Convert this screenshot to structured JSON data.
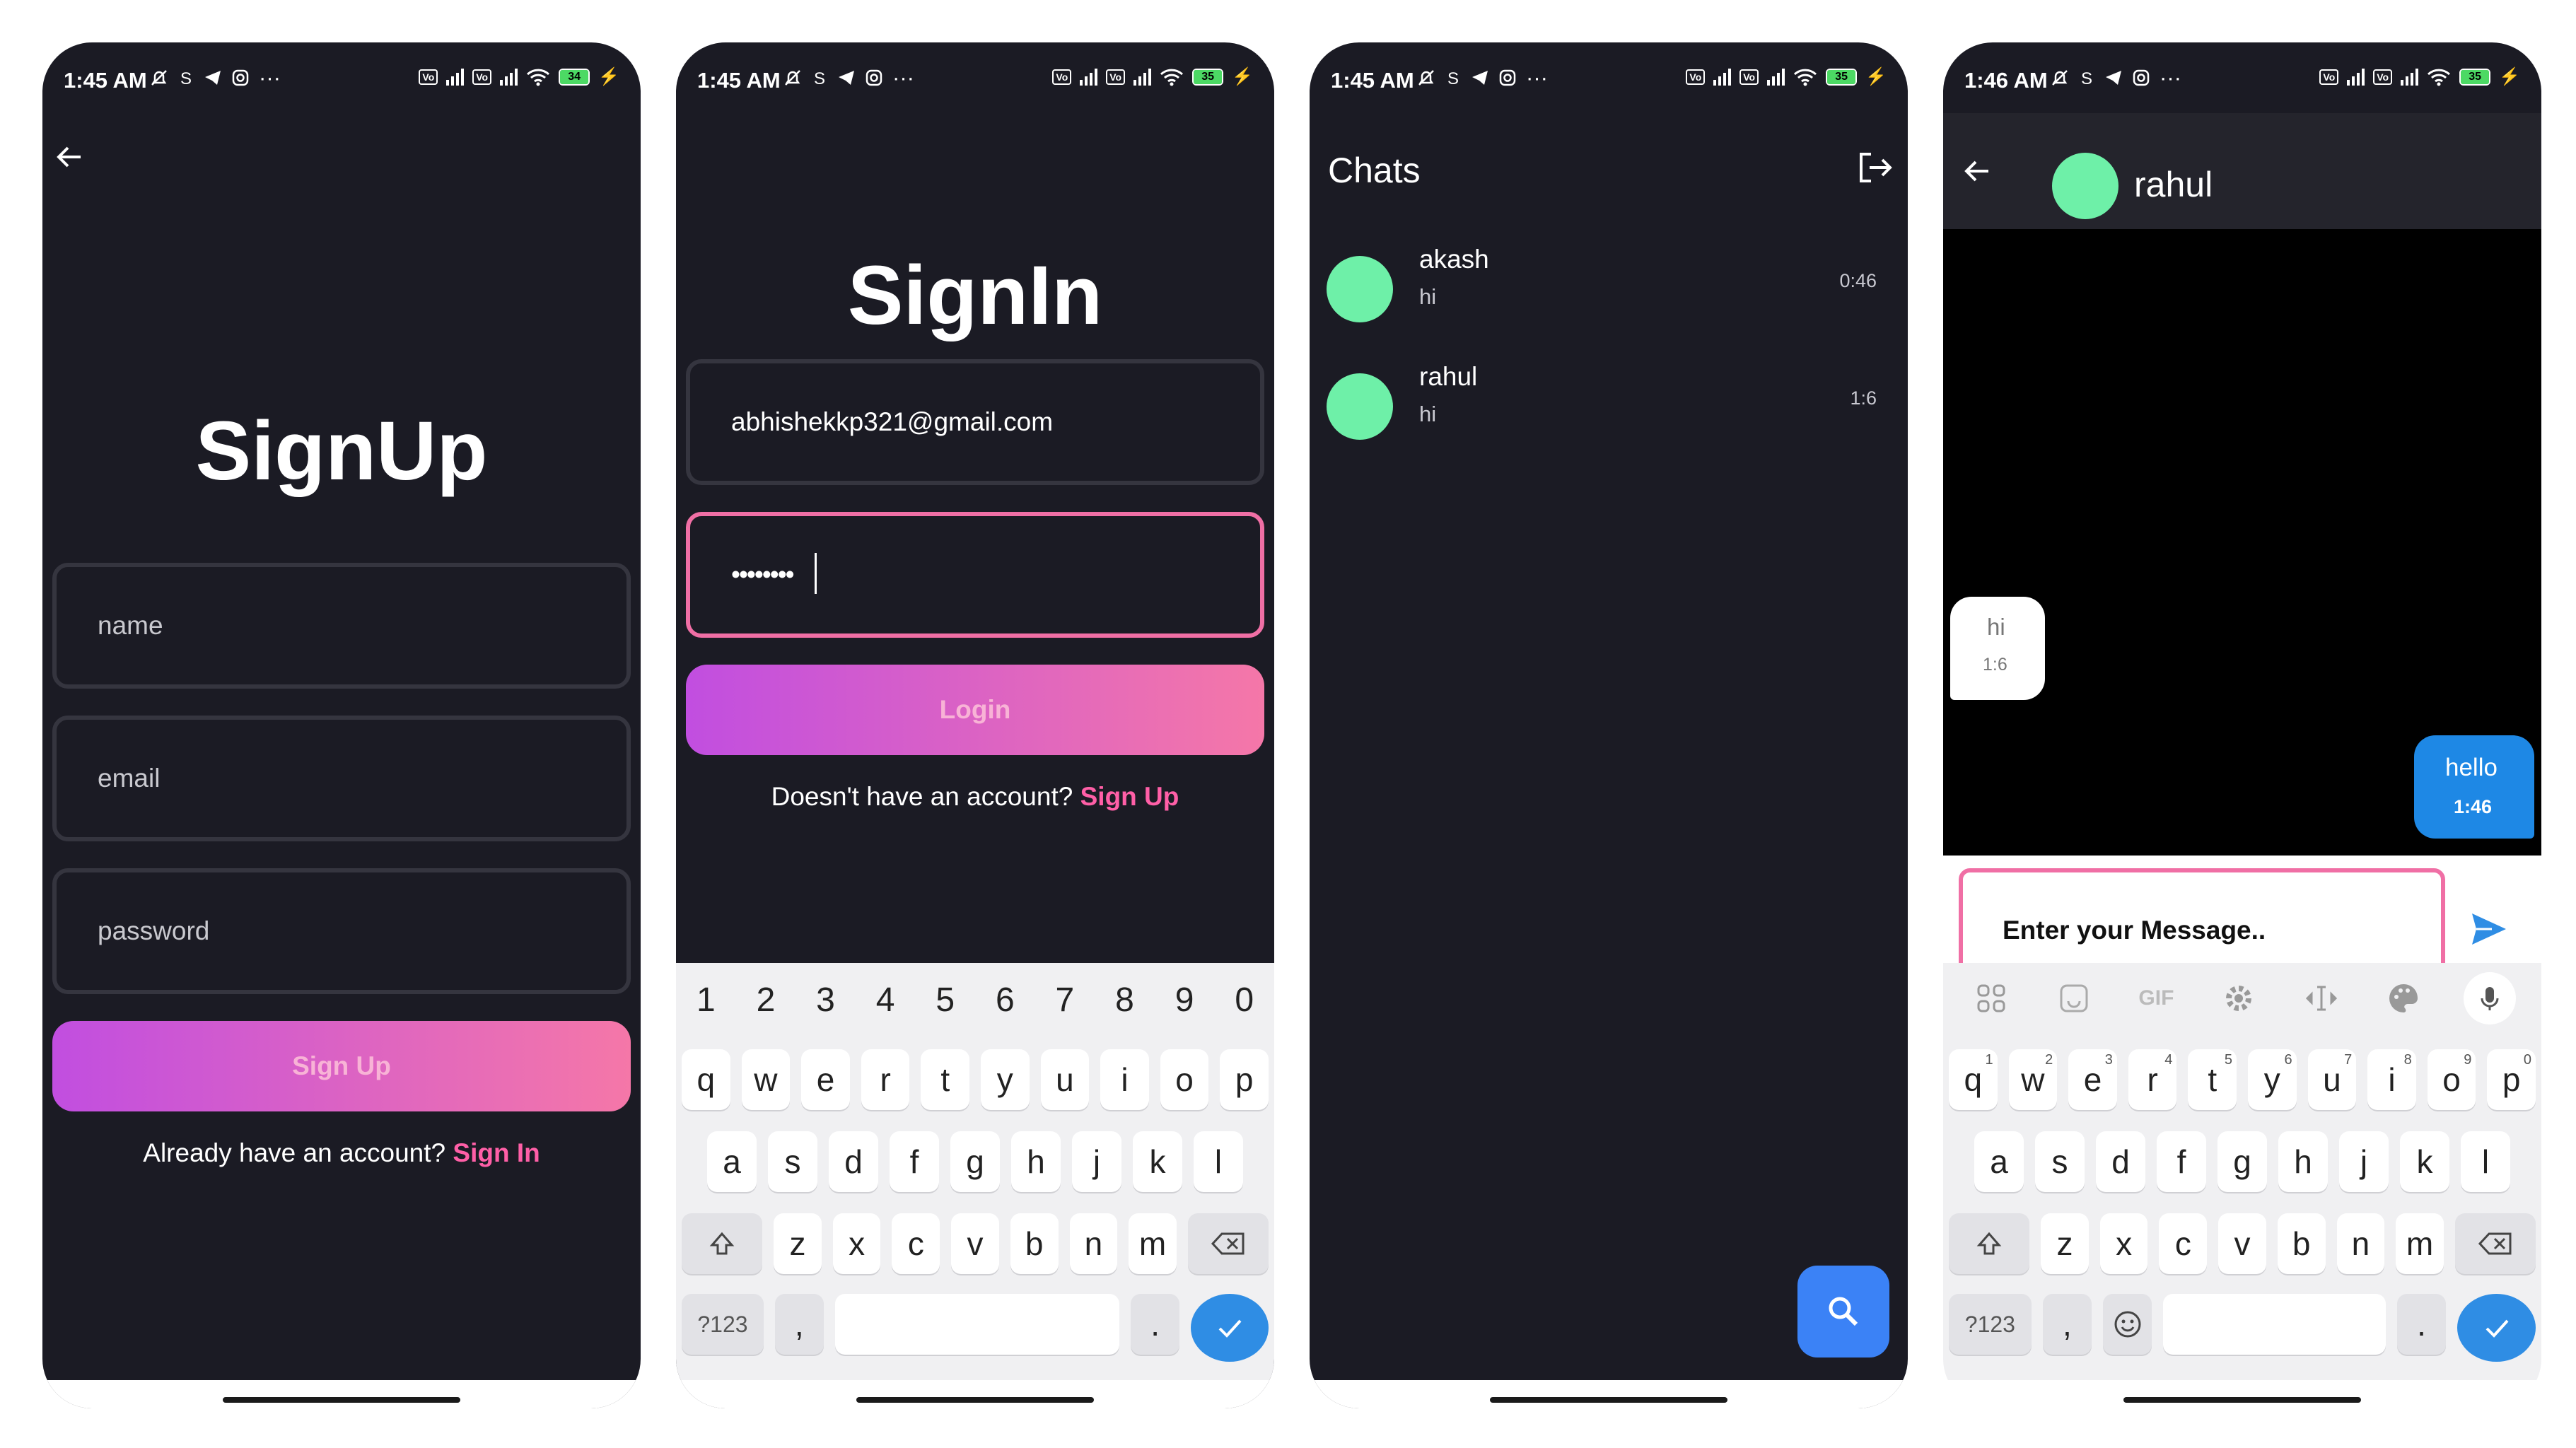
{
  "screens": {
    "signup": {
      "status_time": "1:45 AM",
      "battery": "34",
      "title": "SignUp",
      "name_placeholder": "name",
      "email_placeholder": "email",
      "password_placeholder": "password",
      "button_label": "Sign Up",
      "footer_text": "Already have an account?",
      "footer_link": "Sign In"
    },
    "signin": {
      "status_time": "1:45 AM",
      "battery": "35",
      "title": "SignIn",
      "email_value": "abhishekkp321@gmail.com",
      "password_value": "••••••••",
      "button_label": "Login",
      "footer_text": "Doesn't have an account?",
      "footer_link": "Sign Up"
    },
    "chats": {
      "status_time": "1:45 AM",
      "battery": "35",
      "title": "Chats",
      "items": [
        {
          "name": "akash",
          "last_message": "hi",
          "time": "0:46"
        },
        {
          "name": "rahul",
          "last_message": "hi",
          "time": "1:6"
        }
      ]
    },
    "conversation": {
      "status_time": "1:46 AM",
      "battery": "35",
      "contact_name": "rahul",
      "messages": [
        {
          "text": "hi",
          "time": "1:6",
          "direction": "incoming"
        },
        {
          "text": "hello",
          "time": "1:46",
          "direction": "outgoing"
        }
      ],
      "input_placeholder": "Enter your Message..",
      "toolbar_gif": "GIF"
    }
  },
  "keyboard": {
    "numbers": [
      "1",
      "2",
      "3",
      "4",
      "5",
      "6",
      "7",
      "8",
      "9",
      "0"
    ],
    "row1": [
      "q",
      "w",
      "e",
      "r",
      "t",
      "y",
      "u",
      "i",
      "o",
      "p"
    ],
    "row1_hints": [
      "1",
      "2",
      "3",
      "4",
      "5",
      "6",
      "7",
      "8",
      "9",
      "0"
    ],
    "row2": [
      "a",
      "s",
      "d",
      "f",
      "g",
      "h",
      "j",
      "k",
      "l"
    ],
    "row3": [
      "z",
      "x",
      "c",
      "v",
      "b",
      "n",
      "m"
    ],
    "symbols_label": "?123",
    "comma": ",",
    "period": "."
  },
  "colors": {
    "background": "#1b1b24",
    "accent_pink": "#f06fa5",
    "gradient_start": "#c14ee0",
    "gradient_end": "#f577a8",
    "avatar_green": "#6ef0a8",
    "fab_blue": "#3b82f6",
    "bubble_blue": "#1e88e5"
  },
  "icons": [
    "back-arrow-icon",
    "logout-icon",
    "search-icon",
    "send-icon",
    "check-icon",
    "backspace-icon",
    "shift-icon",
    "mic-icon",
    "emoji-icon",
    "gear-icon",
    "palette-icon"
  ]
}
